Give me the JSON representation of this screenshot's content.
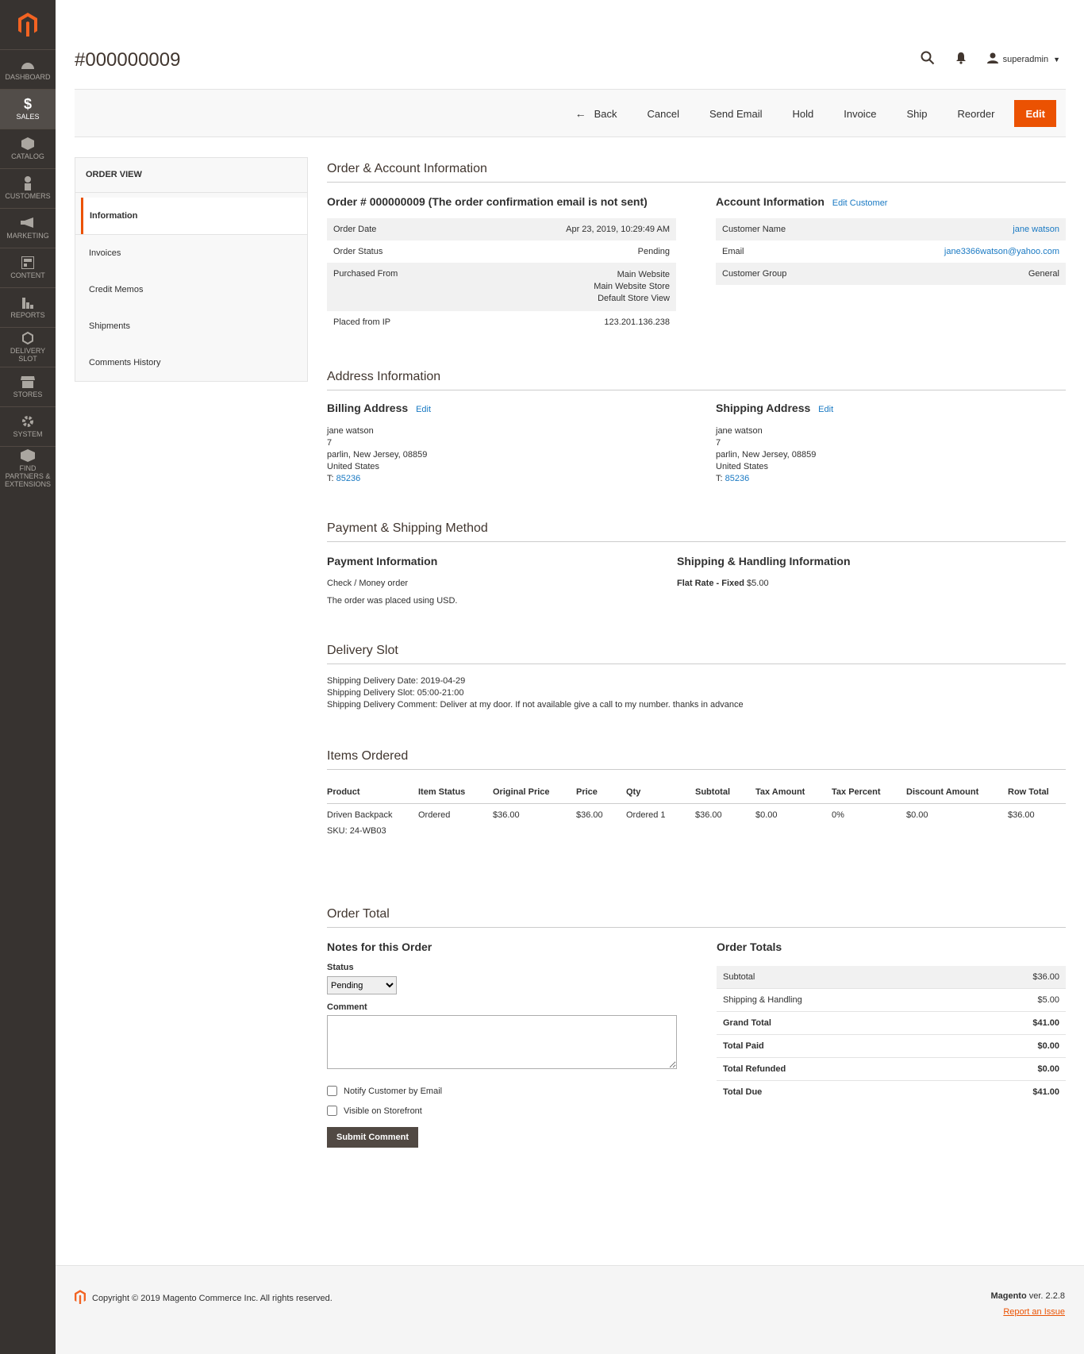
{
  "sidebar": {
    "items": [
      {
        "label": "DASHBOARD",
        "icon": "dashboard-icon"
      },
      {
        "label": "SALES",
        "icon": "dollar-icon"
      },
      {
        "label": "CATALOG",
        "icon": "cube-icon"
      },
      {
        "label": "CUSTOMERS",
        "icon": "person-icon"
      },
      {
        "label": "MARKETING",
        "icon": "megaphone-icon"
      },
      {
        "label": "CONTENT",
        "icon": "layout-icon"
      },
      {
        "label": "REPORTS",
        "icon": "bar-chart-icon"
      },
      {
        "label": "DELIVERY SLOT",
        "icon": "hexagon-icon"
      },
      {
        "label": "STORES",
        "icon": "store-icon"
      },
      {
        "label": "SYSTEM",
        "icon": "gear-icon"
      },
      {
        "label": "FIND PARTNERS & EXTENSIONS",
        "icon": "box-icon"
      }
    ]
  },
  "header": {
    "title": "#000000009",
    "user": "superadmin"
  },
  "actions": [
    "Back",
    "Cancel",
    "Send Email",
    "Hold",
    "Invoice",
    "Ship",
    "Reorder",
    "Edit"
  ],
  "tabs": {
    "title": "ORDER VIEW",
    "items": [
      "Information",
      "Invoices",
      "Credit Memos",
      "Shipments",
      "Comments History"
    ]
  },
  "order_account": {
    "section_title": "Order & Account Information",
    "order_heading": "Order # 000000009 (The order confirmation email is not sent)",
    "order_rows": [
      {
        "label": "Order Date",
        "value": "Apr 23, 2019, 10:29:49 AM"
      },
      {
        "label": "Order Status",
        "value": "Pending"
      },
      {
        "label": "Purchased From",
        "value": [
          "Main Website",
          "Main Website Store",
          "Default Store View"
        ]
      },
      {
        "label": "Placed from IP",
        "value": "123.201.136.238"
      }
    ],
    "account_heading": "Account Information",
    "edit_customer": "Edit Customer",
    "account_rows": [
      {
        "label": "Customer Name",
        "value": "jane watson"
      },
      {
        "label": "Email",
        "value": "jane3366watson@yahoo.com"
      },
      {
        "label": "Customer Group",
        "value": "General"
      }
    ]
  },
  "address": {
    "section_title": "Address Information",
    "billing_heading": "Billing Address",
    "shipping_heading": "Shipping Address",
    "edit": "Edit",
    "lines": [
      "jane watson",
      "7",
      "parlin, New Jersey, 08859",
      "United States"
    ],
    "phone_prefix": "T: ",
    "phone": "85236"
  },
  "payment": {
    "section_title": "Payment & Shipping Method",
    "payment_heading": "Payment Information",
    "method": "Check / Money order",
    "currency_note": "The order was placed using USD.",
    "shipping_heading": "Shipping & Handling Information",
    "shipping_method": "Flat Rate - Fixed",
    "shipping_price": "$5.00"
  },
  "delivery": {
    "section_title": "Delivery Slot",
    "lines": [
      "Shipping Delivery Date: 2019-04-29",
      "Shipping Delivery Slot: 05:00-21:00",
      "Shipping Delivery Comment: Deliver at my door. If not available give a call to my number. thanks in advance"
    ]
  },
  "items": {
    "section_title": "Items Ordered",
    "columns": [
      "Product",
      "Item Status",
      "Original Price",
      "Price",
      "Qty",
      "Subtotal",
      "Tax Amount",
      "Tax Percent",
      "Discount Amount",
      "Row Total"
    ],
    "rows": [
      {
        "product": "Driven Backpack",
        "sku": "SKU: 24-WB03",
        "status": "Ordered",
        "original_price": "$36.00",
        "price": "$36.00",
        "qty": "Ordered 1",
        "subtotal": "$36.00",
        "tax_amount": "$0.00",
        "tax_percent": "0%",
        "discount": "$0.00",
        "row_total": "$36.00"
      }
    ]
  },
  "order_total": {
    "section_title": "Order Total",
    "notes_heading": "Notes for this Order",
    "status_label": "Status",
    "status_value": "Pending",
    "comment_label": "Comment",
    "notify_label": "Notify Customer by Email",
    "visible_label": "Visible on Storefront",
    "submit_label": "Submit Comment",
    "totals_heading": "Order Totals",
    "totals": [
      {
        "label": "Subtotal",
        "value": "$36.00"
      },
      {
        "label": "Shipping & Handling",
        "value": "$5.00"
      },
      {
        "label": "Grand Total",
        "value": "$41.00"
      },
      {
        "label": "Total Paid",
        "value": "$0.00"
      },
      {
        "label": "Total Refunded",
        "value": "$0.00"
      },
      {
        "label": "Total Due",
        "value": "$41.00"
      }
    ]
  },
  "footer": {
    "copyright": "Copyright © 2019 Magento Commerce Inc. All rights reserved.",
    "brand": "Magento",
    "version": " ver. 2.2.8",
    "report": "Report an Issue"
  },
  "colors": {
    "accent": "#eb5202",
    "sidebar": "#373330",
    "link": "#1979c3"
  }
}
